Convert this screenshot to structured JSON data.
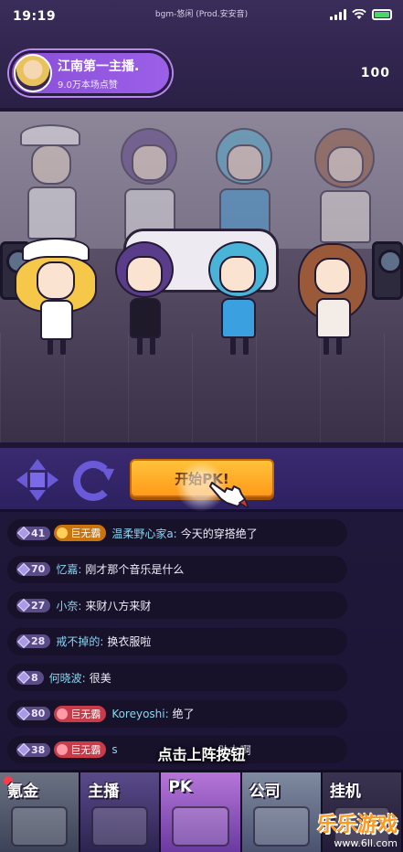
{
  "status_bar": {
    "time": "19:19",
    "song": "bgm-悠闲 (Prod.安安音)",
    "battery_color": "#4ed468"
  },
  "streamer": {
    "name": "江南第一主播.",
    "likes": "9.0万本场点赞"
  },
  "counter": "100",
  "stage": {
    "performers": [
      "captain-blonde",
      "purple-hair",
      "blue-hair",
      "brown-hair"
    ]
  },
  "controls": {
    "start_pk_label": "开始PK!"
  },
  "chat": [
    {
      "level": "41",
      "badge": "巨无霸",
      "badge_style": "gold",
      "user": "温柔野心家a",
      "text": "今天的穿搭绝了"
    },
    {
      "level": "70",
      "badge": "",
      "badge_style": "",
      "user": "忆嘉",
      "text": "刚才那个音乐是什么"
    },
    {
      "level": "27",
      "badge": "",
      "badge_style": "",
      "user": "小奈",
      "text": "来财八方来财"
    },
    {
      "level": "28",
      "badge": "",
      "badge_style": "",
      "user": "戒不掉的",
      "text": "换衣服啦"
    },
    {
      "level": "8",
      "badge": "",
      "badge_style": "",
      "user": "何晓波",
      "text": "很美"
    },
    {
      "level": "80",
      "badge": "巨无霸",
      "badge_style": "red",
      "user": "Koreyoshi",
      "text": "绝了"
    },
    {
      "level": "38",
      "badge": "巨无霸",
      "badge_style": "red",
      "user": "s",
      "text": "助力啊"
    }
  ],
  "tutorial_hint": "点击上阵按钮",
  "bottom_nav": [
    {
      "label": "氪金",
      "icon": "gear-machine-icon"
    },
    {
      "label": "主播",
      "icon": "microphone-icon"
    },
    {
      "label": "PK",
      "icon": "pk-character-icon"
    },
    {
      "label": "公司",
      "icon": "building-icon"
    },
    {
      "label": "挂机",
      "icon": "idle-icon"
    }
  ],
  "watermark": {
    "title": "乐乐游戏",
    "url": "www.6ll.com"
  },
  "colors": {
    "pk_button": "#ff9a1a",
    "username": "#8ad6f0",
    "badge_gold": "#c9740e",
    "badge_red": "#c83c4a"
  }
}
